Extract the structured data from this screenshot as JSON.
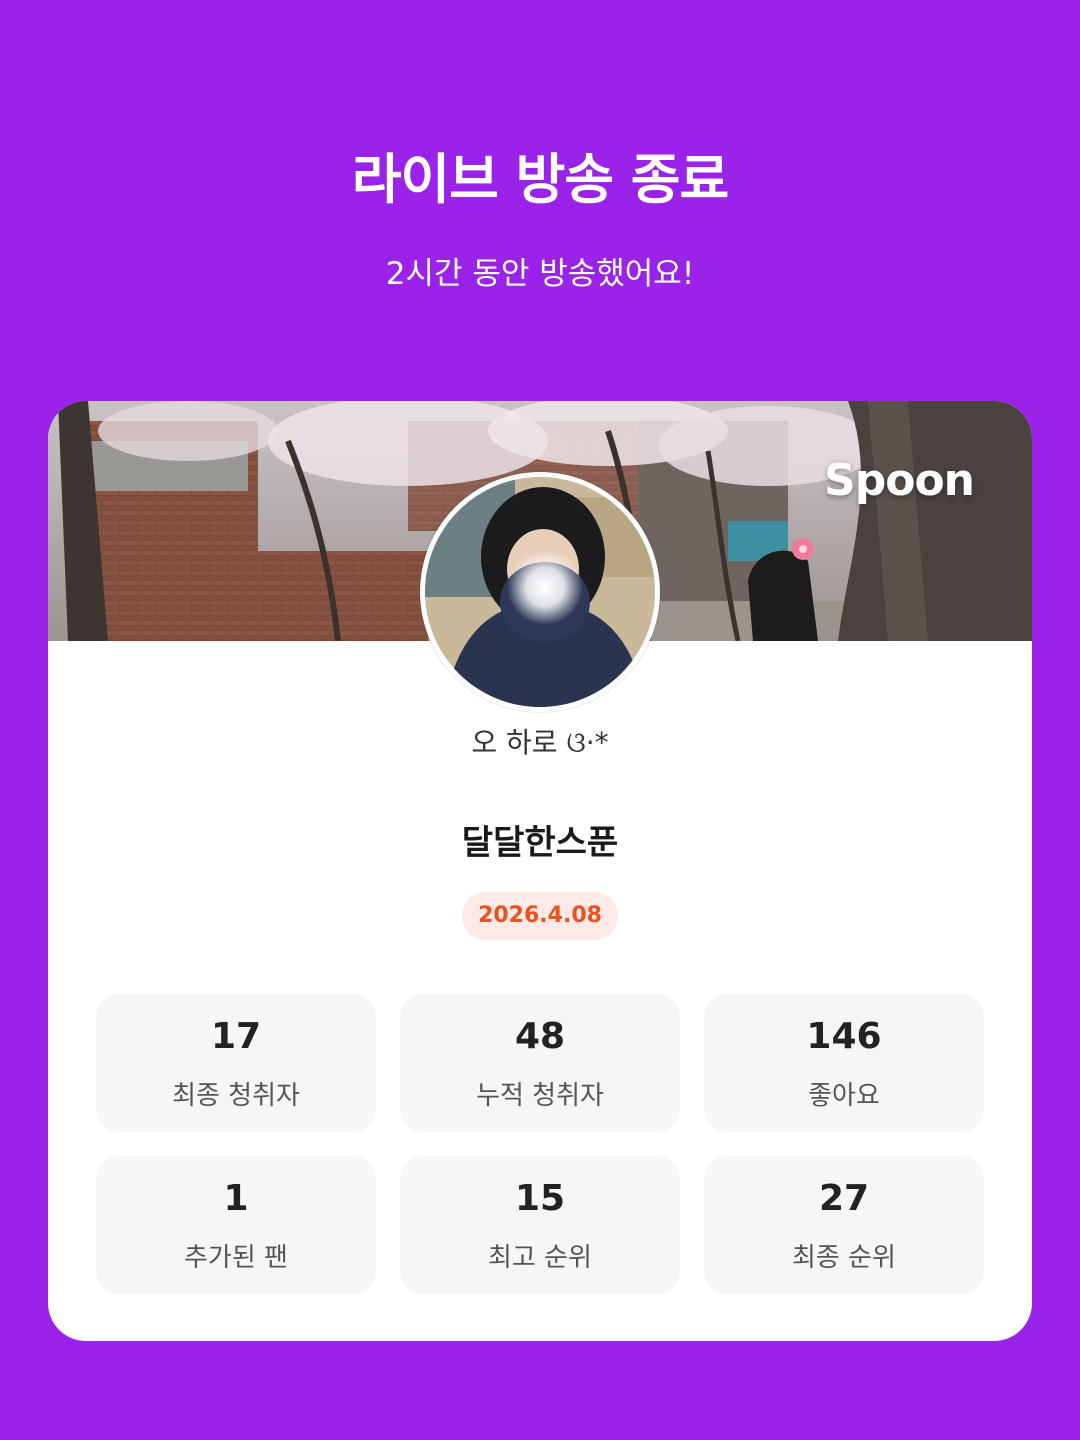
{
  "header": {
    "title": "라이브 방송 종료",
    "subtitle": "2시간 동안 방송했어요!"
  },
  "card": {
    "brand_logo": "Spoon",
    "profile_name": "오 하로 ଓ·*",
    "broadcast_title": "달달한스푼",
    "date": "2026.4.08"
  },
  "stats": [
    {
      "value": "17",
      "label": "최종 청취자"
    },
    {
      "value": "48",
      "label": "누적 청취자"
    },
    {
      "value": "146",
      "label": "좋아요"
    },
    {
      "value": "1",
      "label": "추가된 팬"
    },
    {
      "value": "15",
      "label": "최고 순위"
    },
    {
      "value": "27",
      "label": "최종 순위"
    }
  ],
  "colors": {
    "background": "#9B22E8",
    "card": "#FFFFFF",
    "stat_card": "#F6F6F6",
    "date_badge_bg": "#FDE9E5",
    "date_badge_text": "#E8521F"
  }
}
